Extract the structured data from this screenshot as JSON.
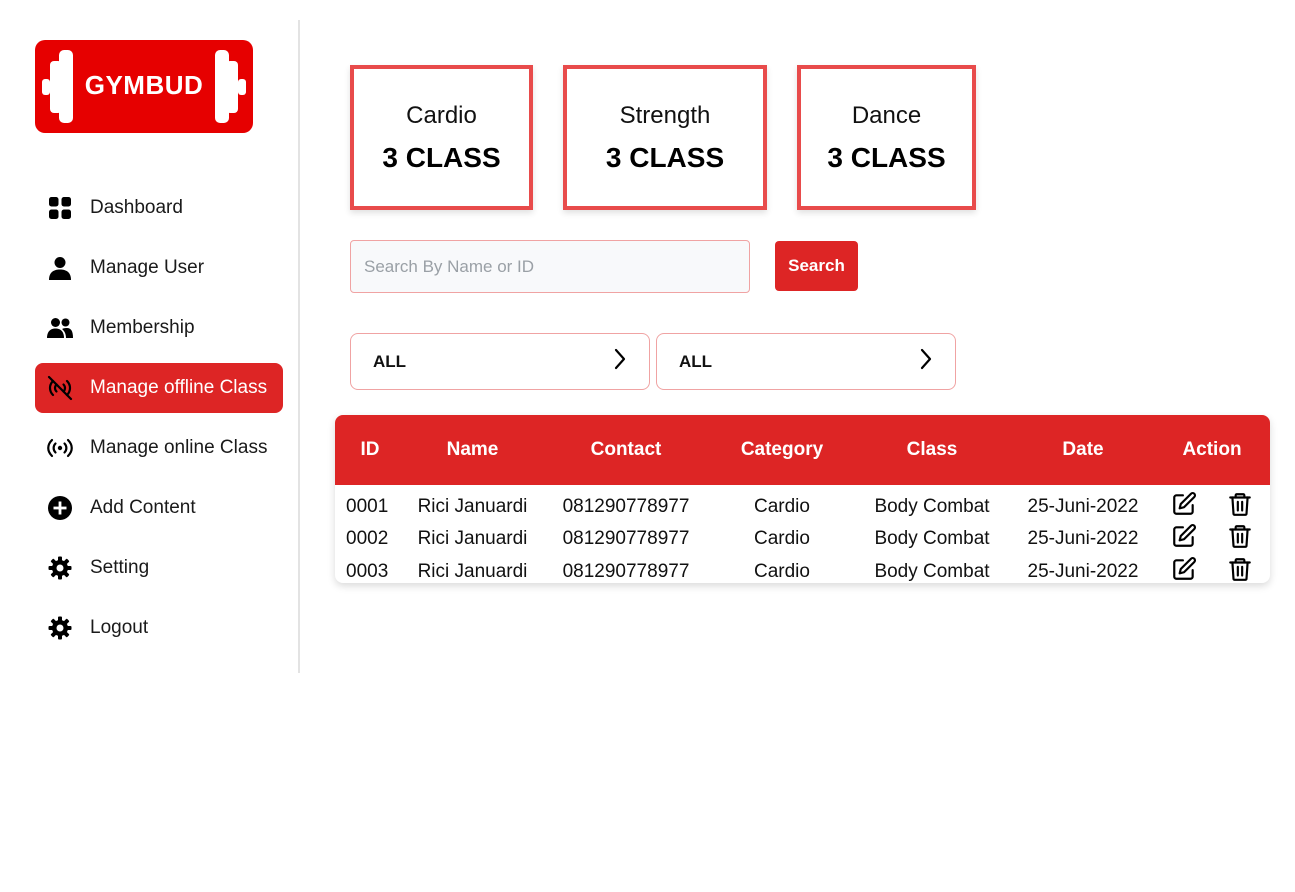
{
  "app": {
    "logo_text": "GYMBUD"
  },
  "sidebar": {
    "items": [
      {
        "label": "Dashboard",
        "icon": "dashboard-grid-icon",
        "active": false
      },
      {
        "label": "Manage User",
        "icon": "user-icon",
        "active": false
      },
      {
        "label": "Membership",
        "icon": "users-group-icon",
        "active": false
      },
      {
        "label": "Manage offline Class",
        "icon": "broadcast-off-icon",
        "active": true
      },
      {
        "label": "Manage online Class",
        "icon": "broadcast-icon",
        "active": false
      },
      {
        "label": "Add Content",
        "icon": "plus-circle-icon",
        "active": false
      },
      {
        "label": "Setting",
        "icon": "gear-icon",
        "active": false
      },
      {
        "label": "Logout",
        "icon": "gear-icon",
        "active": false
      }
    ]
  },
  "stats": [
    {
      "title": "Cardio",
      "value": "3 CLASS"
    },
    {
      "title": "Strength",
      "value": "3 CLASS"
    },
    {
      "title": "Dance",
      "value": "3 CLASS"
    }
  ],
  "search": {
    "placeholder": "Search By Name or ID",
    "value": "",
    "button_label": "Search"
  },
  "filters": [
    {
      "label": "ALL",
      "icon": "chevron-right-icon"
    },
    {
      "label": "ALL",
      "icon": "chevron-right-icon"
    }
  ],
  "table": {
    "headers": [
      "ID",
      "Name",
      "Contact",
      "Category",
      "Class",
      "Date",
      "Action"
    ],
    "rows": [
      {
        "id": "0001",
        "name": "Rici Januardi",
        "contact": "081290778977",
        "category": "Cardio",
        "class": "Body Combat",
        "date": "25-Juni-2022"
      },
      {
        "id": "0002",
        "name": "Rici Januardi",
        "contact": "081290778977",
        "category": "Cardio",
        "class": "Body Combat",
        "date": "25-Juni-2022"
      },
      {
        "id": "0003",
        "name": "Rici Januardi",
        "contact": "081290778977",
        "category": "Cardio",
        "class": "Body Combat",
        "date": "25-Juni-2022"
      }
    ],
    "action_icons": [
      "edit-icon",
      "trash-icon"
    ]
  },
  "colors": {
    "accent": "#dd2525",
    "logo_bg": "#e60000",
    "card_border": "#e84b4b"
  }
}
